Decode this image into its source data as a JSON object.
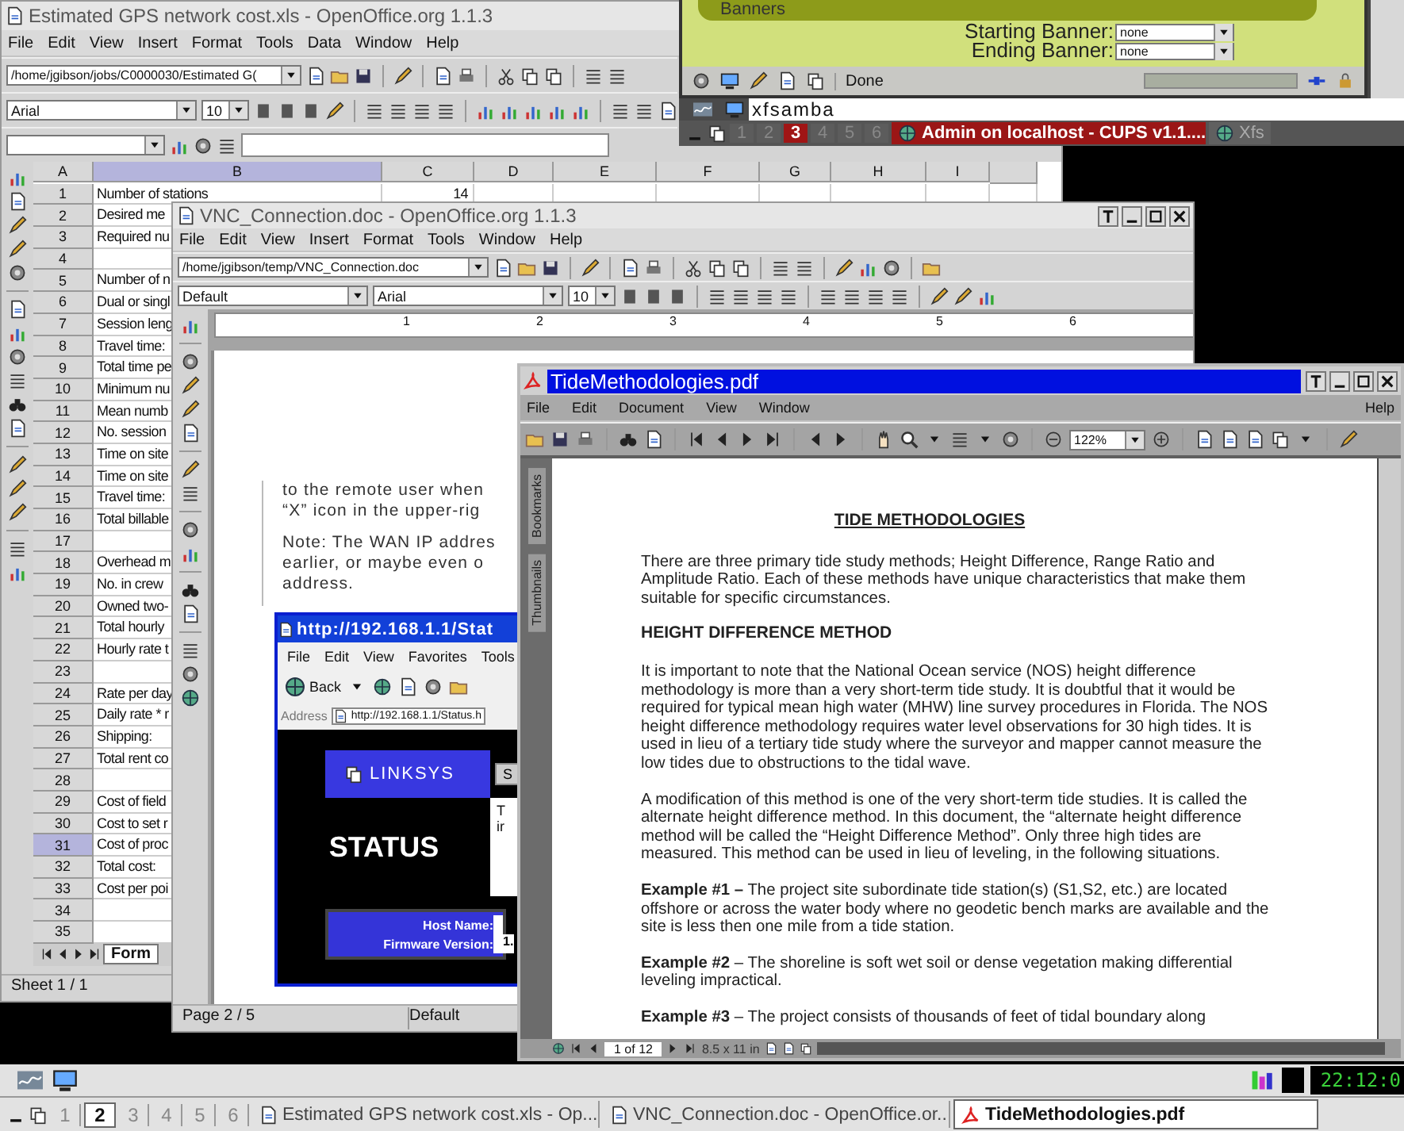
{
  "cups_window": {
    "section_title": "Banners",
    "fields": [
      {
        "label": "Starting Banner:",
        "value": "none"
      },
      {
        "label": "Ending Banner:",
        "value": "none"
      }
    ],
    "status": "Done"
  },
  "top_panel": {
    "run_field": "xfsamba",
    "workspaces": [
      {
        "label": "1",
        "selected": false
      },
      {
        "label": "2",
        "selected": false
      },
      {
        "label": "3",
        "selected": true
      },
      {
        "label": "4",
        "selected": false
      },
      {
        "label": "5",
        "selected": false
      },
      {
        "label": "6",
        "selected": false
      }
    ],
    "tasks": [
      {
        "label": "Admin on localhost - CUPS v1.1....",
        "selected": true
      },
      {
        "label": "Xfs",
        "selected": false
      }
    ]
  },
  "spreadsheet_window": {
    "title": "Estimated GPS network cost.xls - OpenOffice.org 1.1.3",
    "menu": [
      "File",
      "Edit",
      "View",
      "Insert",
      "Format",
      "Tools",
      "Data",
      "Window",
      "Help"
    ],
    "path": "/home/jgibson/jobs/C0000030/Estimated G(",
    "font": "Arial",
    "size": "10",
    "columns": [
      {
        "label": "A",
        "selected": false
      },
      {
        "label": "B",
        "selected": true
      },
      {
        "label": "C",
        "selected": false
      },
      {
        "label": "D",
        "selected": false
      },
      {
        "label": "E",
        "selected": false
      },
      {
        "label": "F",
        "selected": false
      },
      {
        "label": "G",
        "selected": false
      },
      {
        "label": "H",
        "selected": false
      },
      {
        "label": "I",
        "selected": false
      }
    ],
    "rows": [
      {
        "number": "1",
        "cells": [
          "Number of stations",
          "14"
        ],
        "selected": false
      },
      {
        "number": "2",
        "cells": [
          "Desired me"
        ],
        "selected": false
      },
      {
        "number": "3",
        "cells": [
          "Required nu"
        ],
        "selected": false
      },
      {
        "number": "4",
        "cells": [],
        "selected": false
      },
      {
        "number": "5",
        "cells": [
          "Number of n"
        ],
        "selected": false
      },
      {
        "number": "6",
        "cells": [
          "Dual or singl"
        ],
        "selected": false
      },
      {
        "number": "7",
        "cells": [
          "Session leng"
        ],
        "selected": false
      },
      {
        "number": "8",
        "cells": [
          "Travel time:"
        ],
        "selected": false
      },
      {
        "number": "9",
        "cells": [
          "Total time pe"
        ],
        "selected": false
      },
      {
        "number": "10",
        "cells": [
          "Minimum nu"
        ],
        "selected": false
      },
      {
        "number": "11",
        "cells": [
          "Mean numb"
        ],
        "selected": false
      },
      {
        "number": "12",
        "cells": [
          "No. session"
        ],
        "selected": false
      },
      {
        "number": "13",
        "cells": [
          "Time on site"
        ],
        "selected": false
      },
      {
        "number": "14",
        "cells": [
          "Time on site"
        ],
        "selected": false
      },
      {
        "number": "15",
        "cells": [
          "Travel time:"
        ],
        "selected": false
      },
      {
        "number": "16",
        "cells": [
          "Total billable"
        ],
        "selected": false
      },
      {
        "number": "17",
        "cells": [],
        "selected": false
      },
      {
        "number": "18",
        "cells": [
          "Overhead m"
        ],
        "selected": false
      },
      {
        "number": "19",
        "cells": [
          "No. in crew"
        ],
        "selected": false
      },
      {
        "number": "20",
        "cells": [
          "Owned two-"
        ],
        "selected": false
      },
      {
        "number": "21",
        "cells": [
          "Total hourly"
        ],
        "selected": false
      },
      {
        "number": "22",
        "cells": [
          "Hourly rate t"
        ],
        "selected": false
      },
      {
        "number": "23",
        "cells": [],
        "selected": false
      },
      {
        "number": "24",
        "cells": [
          "Rate per day"
        ],
        "selected": false
      },
      {
        "number": "25",
        "cells": [
          "Daily rate * r"
        ],
        "selected": false
      },
      {
        "number": "26",
        "cells": [
          "Shipping:"
        ],
        "selected": false
      },
      {
        "number": "27",
        "cells": [
          "Total rent co"
        ],
        "selected": false
      },
      {
        "number": "28",
        "cells": [],
        "selected": false
      },
      {
        "number": "29",
        "cells": [
          "Cost of field"
        ],
        "selected": false
      },
      {
        "number": "30",
        "cells": [
          "Cost to set r"
        ],
        "selected": false
      },
      {
        "number": "31",
        "cells": [
          "Cost of proc"
        ],
        "selected": true
      },
      {
        "number": "32",
        "cells": [
          "Total cost:"
        ],
        "selected": false
      },
      {
        "number": "33",
        "cells": [
          "Cost per poi"
        ],
        "selected": false
      },
      {
        "number": "34",
        "cells": [],
        "selected": false
      },
      {
        "number": "35",
        "cells": [],
        "selected": false
      }
    ],
    "sheet_tab": "Form",
    "status": "Sheet 1 / 1"
  },
  "writer_window": {
    "title": "VNC_Connection.doc - OpenOffice.org 1.1.3",
    "menu": [
      "File",
      "Edit",
      "View",
      "Insert",
      "Format",
      "Tools",
      "Window",
      "Help"
    ],
    "path": "/home/jgibson/temp/VNC_Connection.doc",
    "style": "Default",
    "font": "Arial",
    "size": "10",
    "ruler": [
      "1",
      "2",
      "3",
      "4",
      "5",
      "6"
    ],
    "paragraphs": [
      [
        "to the remote user when",
        "“X” icon in the upper-rig"
      ],
      [
        "Note: The WAN IP addres",
        "earlier, or maybe even o",
        "address."
      ]
    ],
    "embedded_browser": {
      "title": "http://192.168.1.1/Stat",
      "menu": [
        "File",
        "Edit",
        "View",
        "Favorites",
        "Tools"
      ],
      "back": "Back",
      "address_label": "Address",
      "address": "http://192.168.1.1/Status.h",
      "brand": "LINKSYS",
      "tab": "S",
      "side_text": [
        "T",
        "ir"
      ],
      "heading": "STATUS",
      "info": [
        {
          "label": "Host Name:"
        },
        {
          "label": "Firmware Version:",
          "value": "1."
        }
      ]
    },
    "status": [
      "Page 2 / 5",
      "Default"
    ]
  },
  "pdf_window": {
    "title": "TideMethodologies.pdf",
    "menu": [
      "File",
      "Edit",
      "Document",
      "View",
      "Window"
    ],
    "help": "Help",
    "zoom": "122%",
    "side_tabs": [
      "Bookmarks",
      "Thumbnails"
    ],
    "blocks": [
      {
        "kind": "title",
        "text": "TIDE METHODOLOGIES"
      },
      {
        "kind": "para",
        "text": "There are three primary tide study methods; Height Difference, Range Ratio and Amplitude Ratio.  Each of these methods have unique characteristics that make them suitable for specific circumstances."
      },
      {
        "kind": "heading",
        "text": "HEIGHT DIFFERENCE METHOD"
      },
      {
        "kind": "para",
        "text": "It is important to note that the National Ocean service (NOS) height difference methodology is more than a very short-term tide study.  It is doubtful that it would be required for typical mean high water (MHW) line survey procedures in Florida.  The NOS height difference methodology requires water level observations for 30 high tides. It is used in lieu of a tertiary tide study where the surveyor and mapper cannot measure the low tides due to obstructions to the tidal wave."
      },
      {
        "kind": "para",
        "text": "A modification of this method is one of the very short-term tide studies.  It is called the alternate height difference method.  In this document, the “alternate height difference method will be called the “Height Difference Method”.  Only three high tides are measured.  This method can be used in lieu of leveling, in the following situations."
      },
      {
        "kind": "para",
        "text": "**Example #1 –** The project site subordinate tide station(s) (S1,S2, etc.) are located offshore or across the water body where no geodetic bench marks are available and the site is less then one mile from a tide station."
      },
      {
        "kind": "para",
        "text": "**Example #2** – The shoreline is soft wet soil or dense vegetation making differential leveling impractical."
      },
      {
        "kind": "para",
        "text": "**Example #3** – The project consists of thousands of feet of tidal boundary along"
      }
    ],
    "page_field": "1 of 12",
    "page_size": "8.5 x 11 in"
  },
  "bottom_panel": {
    "clock": "22:12:0",
    "workspaces": [
      {
        "label": "1",
        "selected": false
      },
      {
        "label": "2",
        "selected": true
      },
      {
        "label": "3",
        "selected": false
      },
      {
        "label": "4",
        "selected": false
      },
      {
        "label": "5",
        "selected": false
      },
      {
        "label": "6",
        "selected": false
      }
    ],
    "tasks": [
      {
        "label": "Estimated GPS network cost.xls - Op...",
        "selected": false
      },
      {
        "label": "VNC_Connection.doc - OpenOffice.or...",
        "selected": false
      },
      {
        "label": "TideMethodologies.pdf",
        "selected": true
      }
    ]
  }
}
